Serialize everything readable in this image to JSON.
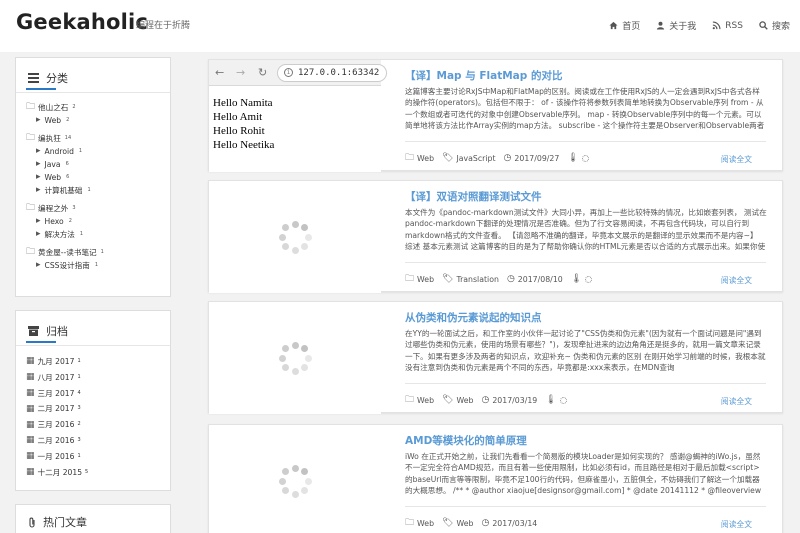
{
  "header": {
    "logo": "Geekaholic",
    "tagline": "编程在于折腾",
    "nav": [
      {
        "icon": "home-icon",
        "label": "首页"
      },
      {
        "icon": "user-icon",
        "label": "关于我"
      },
      {
        "icon": "rss-icon",
        "label": "RSS"
      },
      {
        "icon": "search-icon",
        "label": "搜索"
      }
    ]
  },
  "sidebar": {
    "categories": {
      "title": "分类",
      "groups": [
        {
          "name": "他山之石",
          "count": "2",
          "children": [
            {
              "name": "Web",
              "count": "2"
            }
          ]
        },
        {
          "name": "编执狂",
          "count": "14",
          "children": [
            {
              "name": "Android",
              "count": "1"
            },
            {
              "name": "Java",
              "count": "6"
            },
            {
              "name": "Web",
              "count": "6"
            },
            {
              "name": "计算机基础",
              "count": "1"
            }
          ]
        },
        {
          "name": "编程之外",
          "count": "3",
          "children": [
            {
              "name": "Hexo",
              "count": "2"
            },
            {
              "name": "解决方法",
              "count": "1"
            }
          ]
        },
        {
          "name": "黄金屋--读书笔记",
          "count": "1",
          "children": [
            {
              "name": "CSS设计指南",
              "count": "1"
            }
          ]
        }
      ]
    },
    "archive": {
      "title": "归档",
      "items": [
        {
          "label": "九月 2017",
          "count": "1"
        },
        {
          "label": "八月 2017",
          "count": "1"
        },
        {
          "label": "三月 2017",
          "count": "4"
        },
        {
          "label": "二月 2017",
          "count": "3"
        },
        {
          "label": "三月 2016",
          "count": "2"
        },
        {
          "label": "二月 2016",
          "count": "3"
        },
        {
          "label": "一月 2016",
          "count": "1"
        },
        {
          "label": "十二月 2015",
          "count": "5"
        }
      ]
    },
    "popular": {
      "title": "热门文章"
    }
  },
  "browser_thumb": {
    "url": "127.0.0.1:63342",
    "lines": [
      "Hello Namita",
      "Hello Amit",
      "Hello Rohit",
      "Hello Neetika"
    ]
  },
  "posts": [
    {
      "title": "【译】Map 与 FlatMap 的对比",
      "excerpt": "这篇博客主要讨论RxJS中Map和FlatMap的区别。阅读或在工作使用RxJS的人一定会遇到RxJS中各式各样的操作符(operators)。包括但不限于：  of - 该操作符将参数列表简单地转换为Observable序列 from - 从一个数组或者可迭代的对象中创建Observable序列。 map - 转换Observable序列中的每一个元素。可以简单地将该方法比作Array实例的map方法。 subscribe - 这个操作符主要是Observer和Observable两者的连接点 上面这些是最常用的，你可以知道更多新",
      "category": "Web",
      "tag": "JavaScript",
      "date": "2017/09/27",
      "readmore": "阅读全文"
    },
    {
      "title": "【译】双语对照翻译测试文件",
      "excerpt": "本文件为《pandoc-markdown测试文件》大同小异，再加上一些比较特殊的情况，比如嵌套列表，  测试在pandoc-markdown下翻译的处理情况是否准确。但为了行文容易阅读，不再包含代码块，可以自行到markdown格式的文件查看。 【请忽略不准确的翻译，毕竟本文展示的是翻译的显示效果而不是内容~】 综述 基本元素测试 这篇博客的目的是为了帮助你确认你的HTML元素是否以合适的方式展示出来。如果你使用了CSS重置样式，不要忘记重新自定义你的样式。 标",
      "category": "Web",
      "tag": "Translation",
      "date": "2017/08/10",
      "readmore": "阅读全文"
    },
    {
      "title": "从伪类和伪元素说起的知识点",
      "excerpt": "在YY的一轮面试之后，和工作室的小伙伴一起讨论了\"CSS伪类和伪元素\"(因为就有一个面试问题是问\"遇到过哪些伪类和伪元素，使用的场景有哪些？\")，发现牵扯进来的边边角角还是挺多的，就用一篇文章来记录一下。如果有更多涉及两者的知识点，欢迎补充~ 伪类和伪元素的区别 在刚开始学习前端的时候，我根本就没有注意到伪类和伪元素是两个不同的东西，毕竟都是:xxx来表示，在MDN查询document.querySelectorAll的API时，跳转到了伪类 就像 pseudo",
      "category": "Web",
      "tag": "Web",
      "date": "2017/03/19",
      "readmore": "阅读全文"
    },
    {
      "title": "AMD等模块化的简单原理",
      "excerpt": "iWo 在正式开始之前，让我们先看看一个简易版的模块Loader是如何实现的？ 感谢@蝎神的iWo.js，虽然不一定完全符合AMD规范，而且有着一些使用限制，比如必须有id，而且路径是相对于最后加载<script>的baseUrl而言等等限制，毕竟不足100行的代码，但麻雀虽小，五脏俱全，不妨碍我们了解这一个加载器的大概思想。 /** * @author xiaojue[designsor@gmail.com] * @date 20141112 * @fileoverview core for iwo.a easy module control */(function(win, doc, undef) { var",
      "category": "Web",
      "tag": "Web",
      "date": "2017/03/14",
      "readmore": "阅读全文"
    }
  ]
}
